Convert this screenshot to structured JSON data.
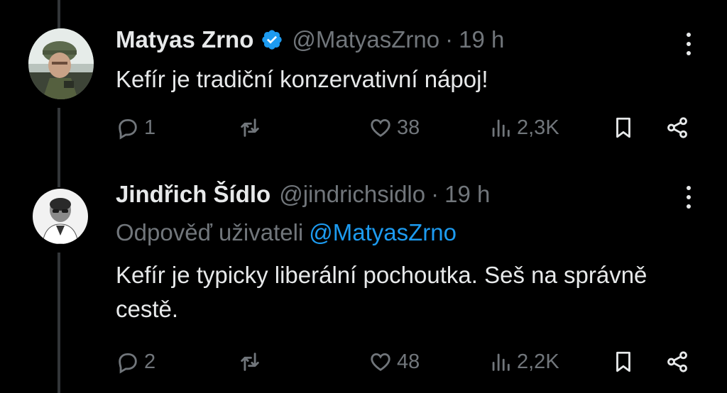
{
  "tweets": [
    {
      "author": "Matyas Zrno",
      "verified": true,
      "handle": "@MatyasZrno",
      "separator": "·",
      "time": "19 h",
      "text": "Kefír je tradiční konzervativní nápoj!",
      "replies": "1",
      "likes": "38",
      "views": "2,3K",
      "avatar": "avatar-soldier-helmet"
    },
    {
      "author": "Jindřich Šídlo",
      "verified": false,
      "handle": "@jindrichsidlo",
      "separator": "·",
      "time": "19 h",
      "replying_prefix": "Odpověď uživateli",
      "replying_to": "@MatyasZrno",
      "text": "Kefír je typicky liberální pochoutka. Seš na správně cestě.",
      "replies": "2",
      "likes": "48",
      "views": "2,2K",
      "avatar": "avatar-bw-portrait"
    }
  ],
  "colors": {
    "background": "#000000",
    "text": "#e7e9ea",
    "muted": "#71767b",
    "accent": "#1d9bf0"
  },
  "icons": [
    "reply-icon",
    "repost-icon",
    "like-icon",
    "views-icon",
    "bookmark-icon",
    "share-icon",
    "more-icon",
    "verified-badge-icon"
  ]
}
